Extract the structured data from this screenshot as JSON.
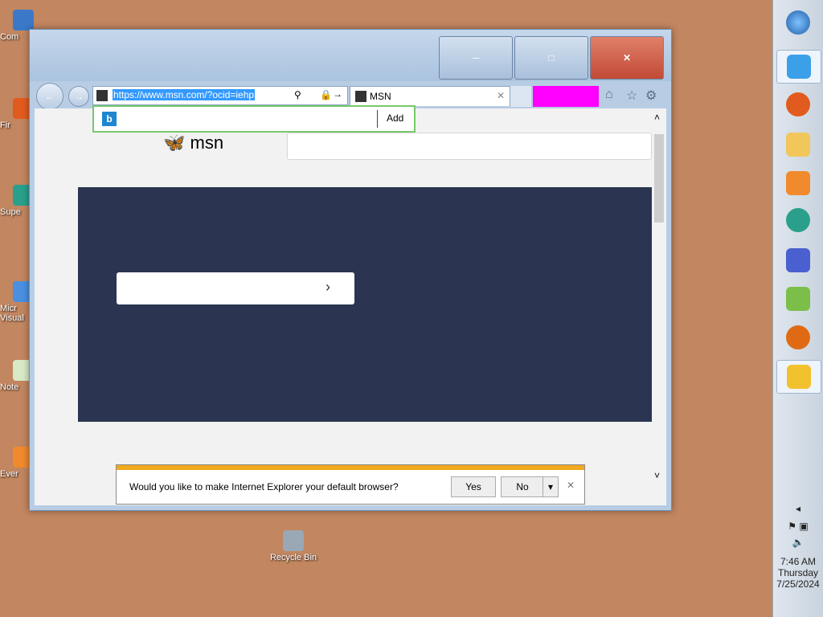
{
  "desktop": {
    "icons": [
      {
        "label": "Com"
      },
      {
        "label": "Fir"
      },
      {
        "label": "Supe"
      },
      {
        "label": "Micr Visual"
      },
      {
        "label": "Note"
      },
      {
        "label": "Ever"
      },
      {
        "label": "Recycle Bin"
      }
    ]
  },
  "browser": {
    "address_url": "https://www.msn.com/?ocid=iehp",
    "tab_title": "MSN",
    "suggest_add": "Add",
    "msn_logo_text": "msn",
    "notification": {
      "message": "Would you like to make Internet Explorer your default browser?",
      "yes": "Yes",
      "no": "No"
    }
  },
  "taskbar": {
    "time": "7:46 AM",
    "day": "Thursday",
    "date": "7/25/2024"
  }
}
